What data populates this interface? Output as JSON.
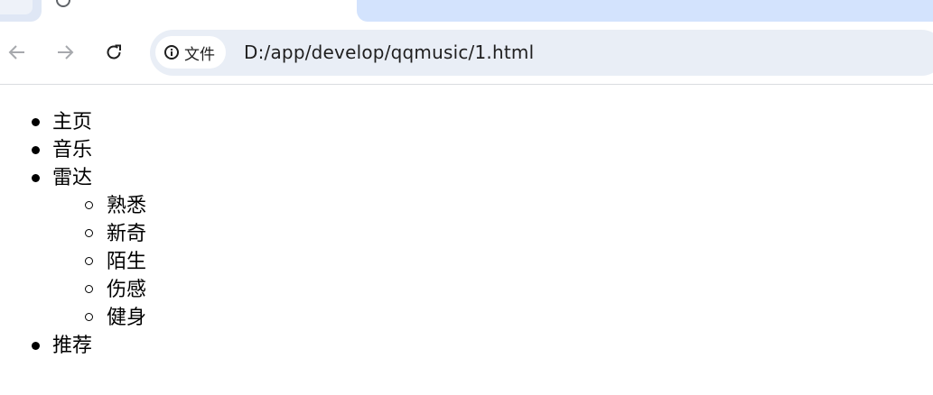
{
  "browser": {
    "security_chip_label": "文件",
    "url": "D:/app/develop/qqmusic/1.html"
  },
  "page": {
    "menu": {
      "items": [
        {
          "label": "主页"
        },
        {
          "label": "音乐"
        },
        {
          "label": "雷达",
          "children": [
            {
              "label": "熟悉"
            },
            {
              "label": "新奇"
            },
            {
              "label": "陌生"
            },
            {
              "label": "伤感"
            },
            {
              "label": "健身"
            }
          ]
        },
        {
          "label": "推荐"
        }
      ]
    }
  },
  "icons": {
    "back": "arrow-left-icon",
    "forward": "arrow-right-icon",
    "reload": "reload-icon",
    "info": "info-icon"
  }
}
